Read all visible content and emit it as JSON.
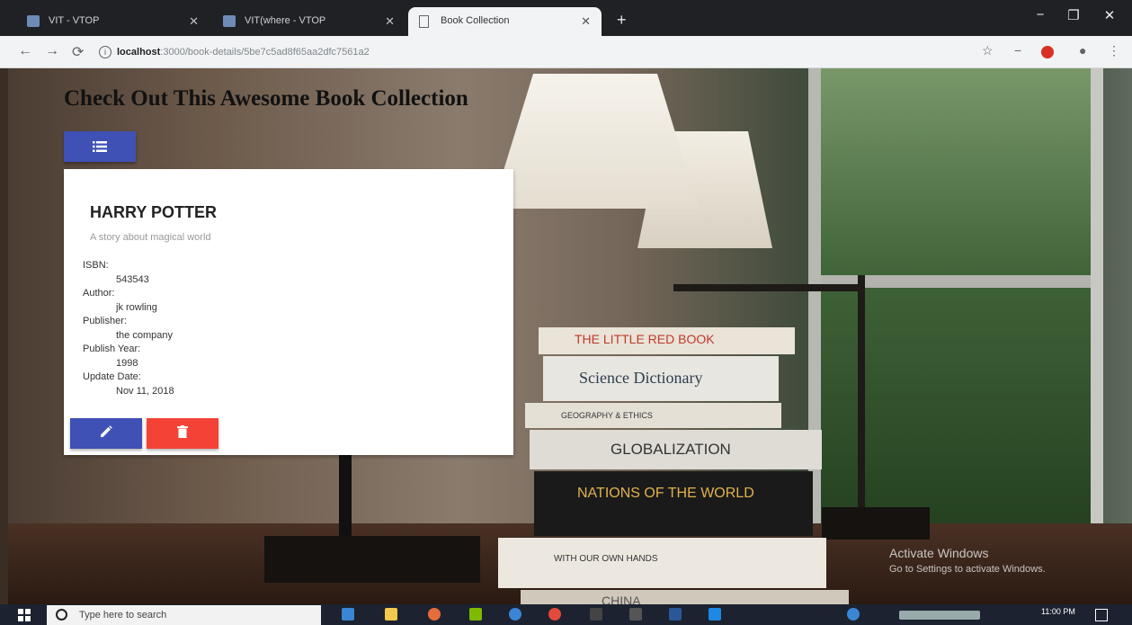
{
  "browser": {
    "tabs": [
      {
        "title": "VIT - VTOP",
        "active": false
      },
      {
        "title": "VIT(where - VTOP",
        "active": false
      },
      {
        "title": "Book Collection",
        "active": true
      }
    ],
    "url_host": "localhost",
    "url_rest": ":3000/book-details/5be7c5ad8f65aa2dfc7561a2",
    "window_controls": {
      "minimize": "−",
      "maximize": "❐",
      "close": "✕"
    }
  },
  "page": {
    "heading": "Check Out This Awesome Book Collection",
    "book": {
      "title": "HARRY POTTER",
      "description": "A story about magical world",
      "fields": [
        {
          "label": "ISBN:",
          "value": "543543"
        },
        {
          "label": "Author:",
          "value": "jk rowling"
        },
        {
          "label": "Publisher:",
          "value": "the company"
        },
        {
          "label": "Publish Year:",
          "value": "1998"
        },
        {
          "label": "Update Date:",
          "value": "Nov 11, 2018"
        }
      ]
    },
    "background_books": [
      {
        "text": "THE LITTLE RED BOOK",
        "color": "#e9e3d8",
        "ink": "#c0392b"
      },
      {
        "text": "Science Dictionary",
        "color": "#e8e6e0",
        "ink": "#2c3e50"
      },
      {
        "text": "GEOGRAPHY & ETHICS",
        "color": "#e5e0d6",
        "ink": "#333333"
      },
      {
        "text": "GLOBALIZATION",
        "color": "#dfdcd5",
        "ink": "#333333"
      },
      {
        "text": "NATIONS OF THE WORLD",
        "color": "#1a1a1a",
        "ink": "#e0b34a"
      },
      {
        "text": "WITH OUR OWN HANDS",
        "color": "#ece8e0",
        "ink": "#333333"
      },
      {
        "text": "CHINA",
        "color": "#cfc8bb",
        "ink": "#555555"
      }
    ]
  },
  "watermark": {
    "title": "Activate Windows",
    "subtitle": "Go to Settings to activate Windows."
  },
  "taskbar": {
    "search_placeholder": "Type here to search",
    "time": "11:00 PM"
  },
  "colors": {
    "primary": "#3f51b5",
    "danger": "#f44336"
  }
}
